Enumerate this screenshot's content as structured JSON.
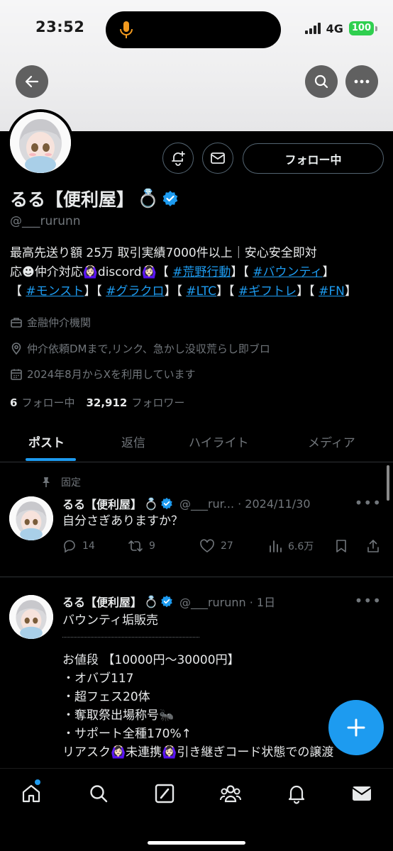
{
  "status_bar": {
    "time": "23:52",
    "network": "4G",
    "battery": "100"
  },
  "profile": {
    "display_name": "るる【便利屋】",
    "name_emoji": "💍",
    "handle": "@___rurunn",
    "follow_button": "フォロー中",
    "bio_line1": "最高先送り額 25万 取引実績7000件以上｜安心安全即対",
    "bio_line2_prefix": "応☻仲介対応",
    "bio_emoji": "🙆🏻‍♀️",
    "bio_discord": "discord",
    "tags": [
      "#荒野行動",
      "#バウンティ",
      "#モンスト",
      "#グラクロ",
      "#LTC",
      "#ギフトレ",
      "#FN"
    ],
    "category": "金融仲介機関",
    "location": "仲介依頼DMまで,リンク、急かし没収荒らし即ブロ",
    "joined": "2024年8月からXを利用しています",
    "following_count": "6",
    "following_label": "フォロー中",
    "followers_count": "32,912",
    "followers_label": "フォロワー"
  },
  "tabs": [
    {
      "label": "ポスト"
    },
    {
      "label": "返信"
    },
    {
      "label": "ハイライト"
    },
    {
      "label": "メディア"
    }
  ],
  "posts": [
    {
      "pinned_label": "固定",
      "name": "るる【便利屋】",
      "name_emoji": "💍",
      "handle_time": "@___rur... · 2024/11/30",
      "text": "自分さぎありますか？",
      "replies": "14",
      "reposts": "9",
      "likes": "27",
      "views": "6.6万"
    },
    {
      "name": "るる【便利屋】",
      "name_emoji": "💍",
      "handle_time": "@___rurunn · 1日",
      "title": "バウンティ垢販売",
      "lines": [
        "お値段 【10000円〜30000円】",
        "・オバブ117",
        "・超フェス20体",
        "・奪取祭出場称号🐜",
        "・サポート全種170%↑",
        "リアスク🙆🏻‍♀️未連携🙆🏻‍♀️引き継ぎコード状態での譲渡"
      ]
    }
  ],
  "colors": {
    "accent": "#1d9bf0",
    "muted": "#71767b",
    "text": "#e7e9ea",
    "verified": "#1d9bf0"
  }
}
